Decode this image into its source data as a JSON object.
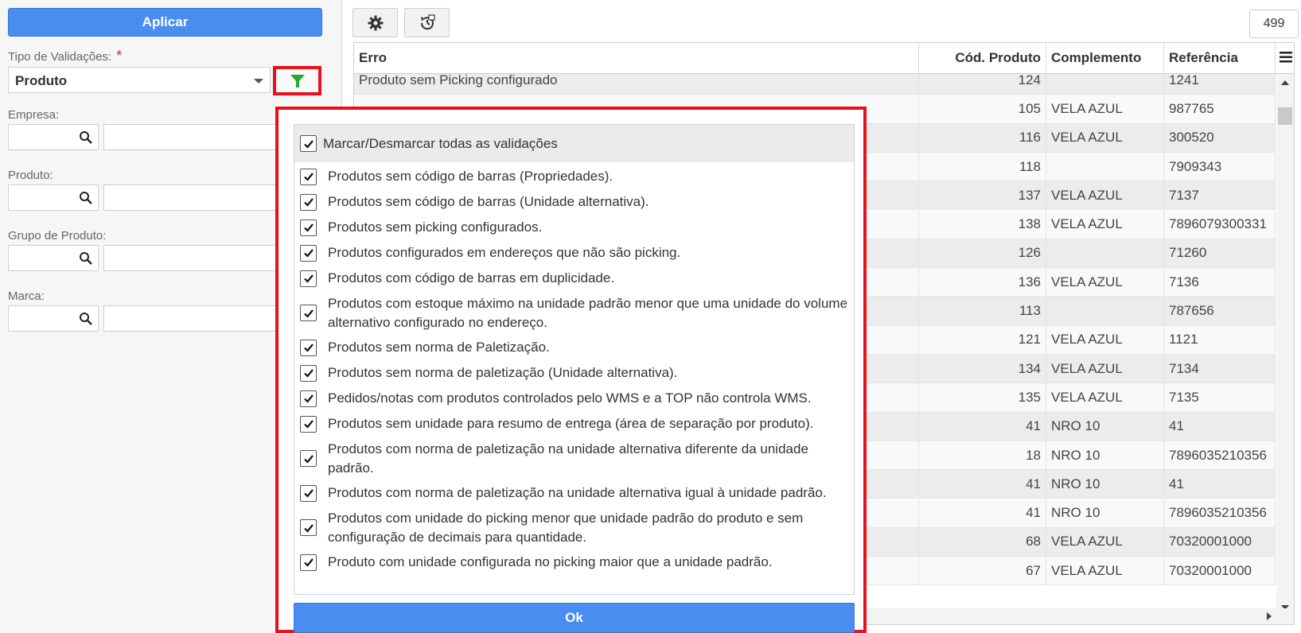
{
  "sidebar": {
    "apply_label": "Aplicar",
    "validation_type_label": "Tipo de Validações:",
    "required_mark": "*",
    "validation_type_value": "Produto",
    "empresa_label": "Empresa:",
    "produto_label": "Produto:",
    "grupo_label": "Grupo de Produto:",
    "marca_label": "Marca:"
  },
  "toolbar": {
    "settings_icon": "gear-icon",
    "history_icon": "clock-refresh-icon",
    "record_count": "499"
  },
  "grid": {
    "columns": [
      "Erro",
      "Cód. Produto",
      "Complemento",
      "Referência"
    ],
    "rows": [
      {
        "erro": "Produto sem Picking configurado",
        "cod": "124",
        "comp": "",
        "ref": "1241"
      },
      {
        "erro": "",
        "cod": "105",
        "comp": "VELA AZUL",
        "ref": "987765"
      },
      {
        "erro": "",
        "cod": "116",
        "comp": "VELA AZUL",
        "ref": "300520"
      },
      {
        "erro": "",
        "cod": "118",
        "comp": "",
        "ref": "7909343"
      },
      {
        "erro": "",
        "cod": "137",
        "comp": "VELA AZUL",
        "ref": "7137"
      },
      {
        "erro": "",
        "cod": "138",
        "comp": "VELA AZUL",
        "ref": "7896079300331"
      },
      {
        "erro": "",
        "cod": "126",
        "comp": "",
        "ref": "71260"
      },
      {
        "erro": "",
        "cod": "136",
        "comp": "VELA AZUL",
        "ref": "7136"
      },
      {
        "erro": "",
        "cod": "113",
        "comp": "",
        "ref": "787656"
      },
      {
        "erro": "",
        "cod": "121",
        "comp": "VELA AZUL",
        "ref": "1121"
      },
      {
        "erro": "",
        "cod": "134",
        "comp": "VELA AZUL",
        "ref": "7134"
      },
      {
        "erro": "",
        "cod": "135",
        "comp": "VELA AZUL",
        "ref": "7135"
      },
      {
        "erro": "",
        "cod": "41",
        "comp": "NRO 10",
        "ref": "41"
      },
      {
        "erro": "",
        "cod": "18",
        "comp": "NRO 10",
        "ref": "7896035210356"
      },
      {
        "erro": "",
        "cod": "41",
        "comp": "NRO 10",
        "ref": "41"
      },
      {
        "erro": "",
        "cod": "41",
        "comp": "NRO 10",
        "ref": "7896035210356"
      },
      {
        "erro": "",
        "cod": "68",
        "comp": "VELA AZUL",
        "ref": "70320001000"
      },
      {
        "erro": "",
        "cod": "67",
        "comp": "VELA AZUL",
        "ref": "70320001000"
      }
    ]
  },
  "popup": {
    "select_all_label": "Marcar/Desmarcar todas as validações",
    "ok_label": "Ok",
    "options": [
      "Produtos sem código de barras (Propriedades).",
      "Produtos sem código de barras (Unidade alternativa).",
      "Produtos sem picking configurados.",
      "Produtos configurados em endereços que não são picking.",
      "Produtos com código de barras em duplicidade.",
      "Produtos com estoque máximo na unidade padrão menor que uma unidade do volume alternativo configurado no endereço.",
      "Produtos sem norma de Paletização.",
      "Produtos sem norma de paletização (Unidade alternativa).",
      "Pedidos/notas com produtos controlados pelo WMS e a TOP não controla WMS.",
      "Produtos sem unidade para resumo de entrega (área de separação por produto).",
      "Produtos com norma de paletização na unidade alternativa diferente da unidade padrão.",
      "Produtos com norma de paletização na unidade alternativa igual à unidade padrão.",
      "Produtos com unidade do picking menor que unidade padrão do produto e sem configuração de decimais para quantidade.",
      "Produto com unidade configurada no picking maior que a unidade padrão."
    ]
  },
  "colors": {
    "primary": "#4a8df0",
    "highlight": "#e8101a",
    "filter_icon": "#22aa33"
  }
}
